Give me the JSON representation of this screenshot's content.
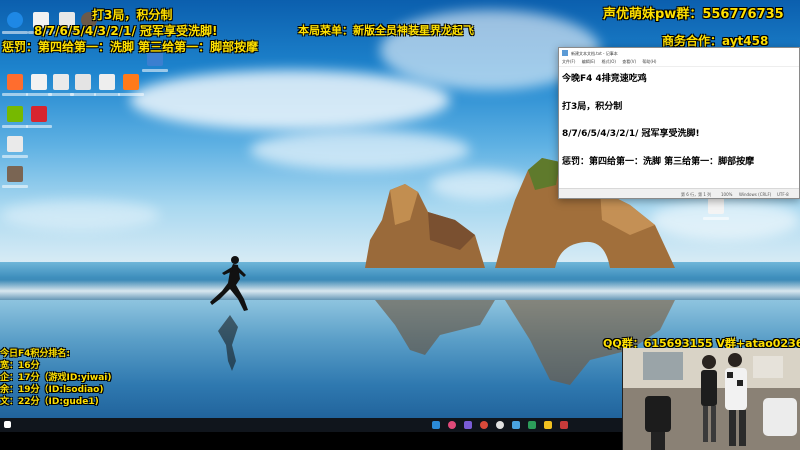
{
  "overlay": {
    "top_left_line1": "打3局，积分制",
    "top_left_line2": "8/7/6/5/4/3/2/1/  冠军享受洗脚!",
    "top_left_line3": "惩罚：第四给第一：洗脚   第三给第一：脚部按摩",
    "menu_banner": "本局菜单：新版全员神装星界龙起飞",
    "group_label": "声优萌妹pw群：556776735",
    "business_label": "商务合作：ayt458",
    "qq_label": "QQ群：615693155 V群+atao0236"
  },
  "ranking": {
    "title": "今日F4积分排名:",
    "rows": [
      "宽：16分",
      "企：17分（游戏ID:yiwai)",
      "余：19分（ID:lsodiao)",
      "文：22分（ID:gude1)"
    ]
  },
  "notepad": {
    "title": "新建文本文档.txt - 记事本",
    "menu": [
      "文件(F)",
      "编辑(E)",
      "格式(O)",
      "查看(V)",
      "帮助(H)"
    ],
    "lines": [
      "今晚F4  4排竞速吃鸡",
      "",
      "打3局，积分制",
      "",
      "8/7/6/5/4/3/2/1/  冠军享受洗脚!",
      "",
      "惩罚：第四给第一：洗脚    第三给第一：脚部按摩"
    ],
    "status": {
      "position": "第 6 行，第 1 列",
      "zoom": "100%",
      "eol": "Windows (CRLF)",
      "encoding": "UTF-8"
    }
  },
  "desktop_icons": [
    {
      "name": "app-icon-blue-circle",
      "color": "#1e88e5"
    },
    {
      "name": "file-icon",
      "color": "#f2f2f2"
    },
    {
      "name": "file-icon",
      "color": "#e8e8e8"
    },
    {
      "name": "app-icon-orange",
      "color": "#ff6d2e"
    },
    {
      "name": "nvidia-icon",
      "color": "#76b900"
    },
    {
      "name": "app-icon-red",
      "color": "#d8252f"
    },
    {
      "name": "file-icon",
      "color": "#e8e8e8"
    },
    {
      "name": "avatar-icon",
      "color": "#6b5a4a"
    }
  ],
  "colors": {
    "overlay_yellow": "#ffe000",
    "overlay_white": "#ffffff",
    "taskbar": "#10151c"
  }
}
